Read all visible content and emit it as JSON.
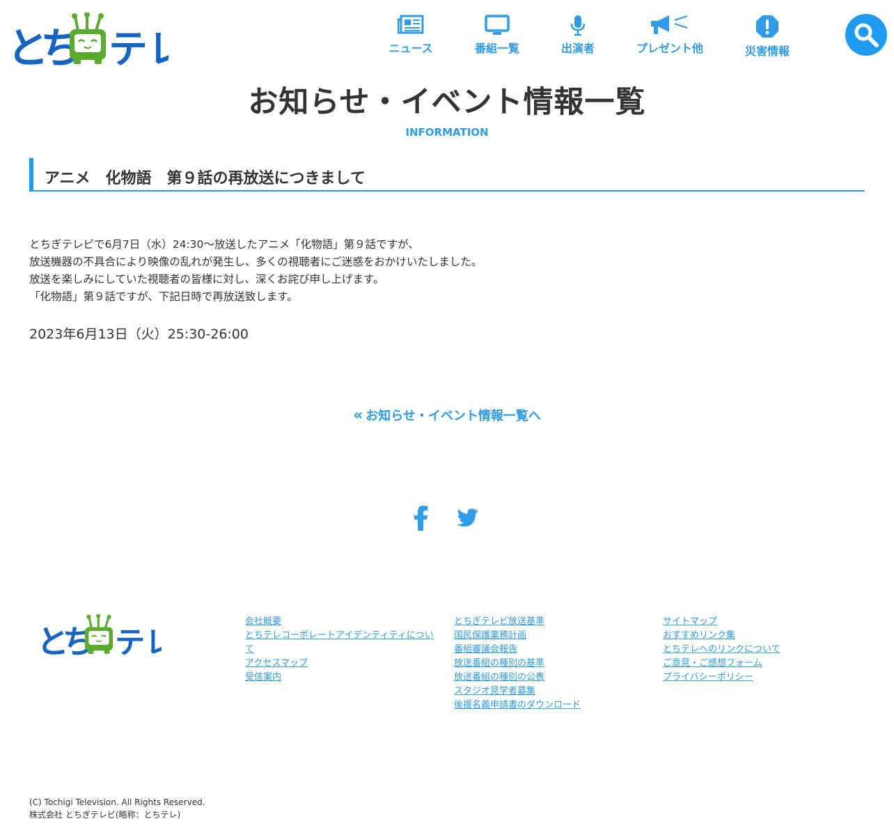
{
  "brand": {
    "logo_text": "とちテレ",
    "primary_color": "#1e9bf0",
    "logo_color": "#1565c0",
    "mascot_color": "#5aaa2e"
  },
  "nav": {
    "items": [
      {
        "label": "ニュース",
        "icon": "newspaper-icon"
      },
      {
        "label": "番組一覧",
        "icon": "tv-icon"
      },
      {
        "label": "出演者",
        "icon": "microphone-icon"
      },
      {
        "label": "プレゼント他",
        "icon": "megaphone-icon"
      },
      {
        "label": "災害情報",
        "icon": "warning-icon"
      }
    ],
    "search_icon": "search-icon"
  },
  "page": {
    "title": "お知らせ・イベント情報一覧",
    "subtitle": "INFORMATION"
  },
  "article": {
    "title": "アニメ　化物語　第９話の再放送につきまして",
    "body": [
      "とちぎテレビで6月7日（水）24:30～放送したアニメ「化物語」第９話ですが、",
      "放送機器の不具合により映像の乱れが発生し、多くの視聴者にご迷惑をおかけいたしました。",
      "放送を楽しみにしていた視聴者の皆様に対し、深くお詫び申し上げます。",
      "「化物語」第９話ですが、下記日時で再放送致します。"
    ],
    "rebroadcast": "2023年6月13日（火）25:30-26:00",
    "back_link": "お知らせ・イベント情報一覧へ"
  },
  "social": {
    "items": [
      "facebook-icon",
      "twitter-icon"
    ]
  },
  "footer": {
    "columns": [
      [
        "会社概要",
        "とちテレコーポレートアイデンティティについて",
        "アクセスマップ",
        "受信案内"
      ],
      [
        "とちぎテレビ放送基準",
        "国民保護業務計画",
        "番組審議会報告",
        "放送番組の種別の基準",
        "放送番組の種別の公表",
        "スタジオ見学者募集",
        "後援名義申請書のダウンロード"
      ],
      [
        "サイトマップ",
        "おすすめリンク集",
        "とちテレへのリンクについて",
        "ご意見・ご感想フォーム",
        "プライバシーポリシー"
      ]
    ],
    "copyright": "(C) Tochigi Television. All Rights Reserved.",
    "company": "株式会社 とちぎテレビ(略称：とちテレ)"
  }
}
